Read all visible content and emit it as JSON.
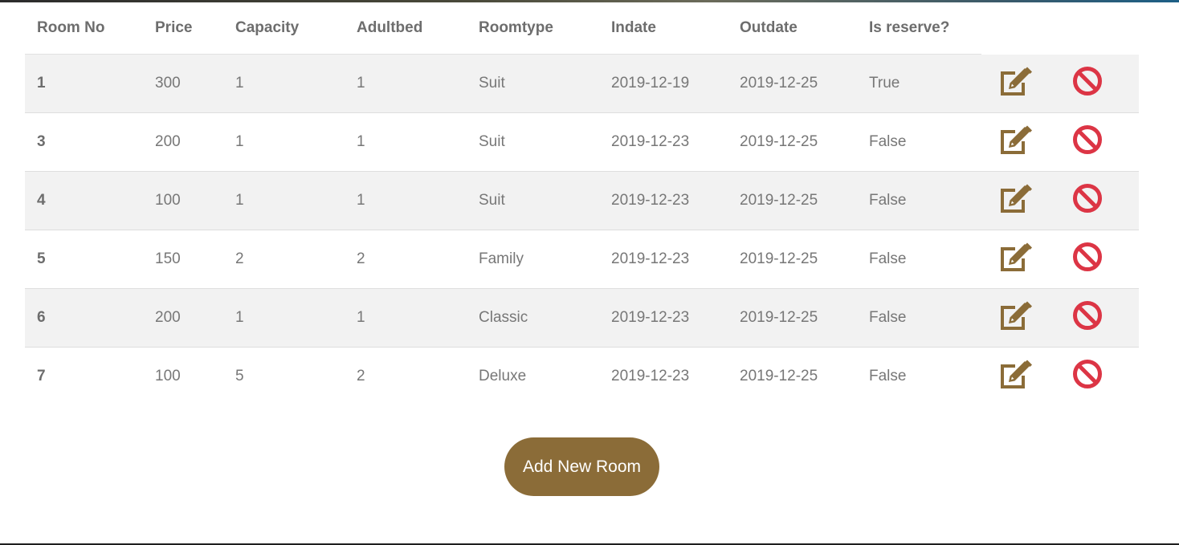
{
  "table": {
    "headers": [
      "Room No",
      "Price",
      "Capacity",
      "Adultbed",
      "Roomtype",
      "Indate",
      "Outdate",
      "Is reserve?"
    ],
    "rows": [
      {
        "room_no": "1",
        "price": "300",
        "capacity": "1",
        "adultbed": "1",
        "roomtype": "Suit",
        "indate": "2019-12-19",
        "outdate": "2019-12-25",
        "is_reserve": "True"
      },
      {
        "room_no": "3",
        "price": "200",
        "capacity": "1",
        "adultbed": "1",
        "roomtype": "Suit",
        "indate": "2019-12-23",
        "outdate": "2019-12-25",
        "is_reserve": "False"
      },
      {
        "room_no": "4",
        "price": "100",
        "capacity": "1",
        "adultbed": "1",
        "roomtype": "Suit",
        "indate": "2019-12-23",
        "outdate": "2019-12-25",
        "is_reserve": "False"
      },
      {
        "room_no": "5",
        "price": "150",
        "capacity": "2",
        "adultbed": "2",
        "roomtype": "Family",
        "indate": "2019-12-23",
        "outdate": "2019-12-25",
        "is_reserve": "False"
      },
      {
        "room_no": "6",
        "price": "200",
        "capacity": "1",
        "adultbed": "1",
        "roomtype": "Classic",
        "indate": "2019-12-23",
        "outdate": "2019-12-25",
        "is_reserve": "False"
      },
      {
        "room_no": "7",
        "price": "100",
        "capacity": "5",
        "adultbed": "2",
        "roomtype": "Deluxe",
        "indate": "2019-12-23",
        "outdate": "2019-12-25",
        "is_reserve": "False"
      }
    ],
    "row_actions": {
      "edit_icon": "edit-icon",
      "delete_icon": "ban-icon"
    }
  },
  "add_button": {
    "label": "Add New Room"
  },
  "colors": {
    "accent": "#8b6c38",
    "danger": "#dc3545",
    "stripe": "#f2f2f2"
  }
}
